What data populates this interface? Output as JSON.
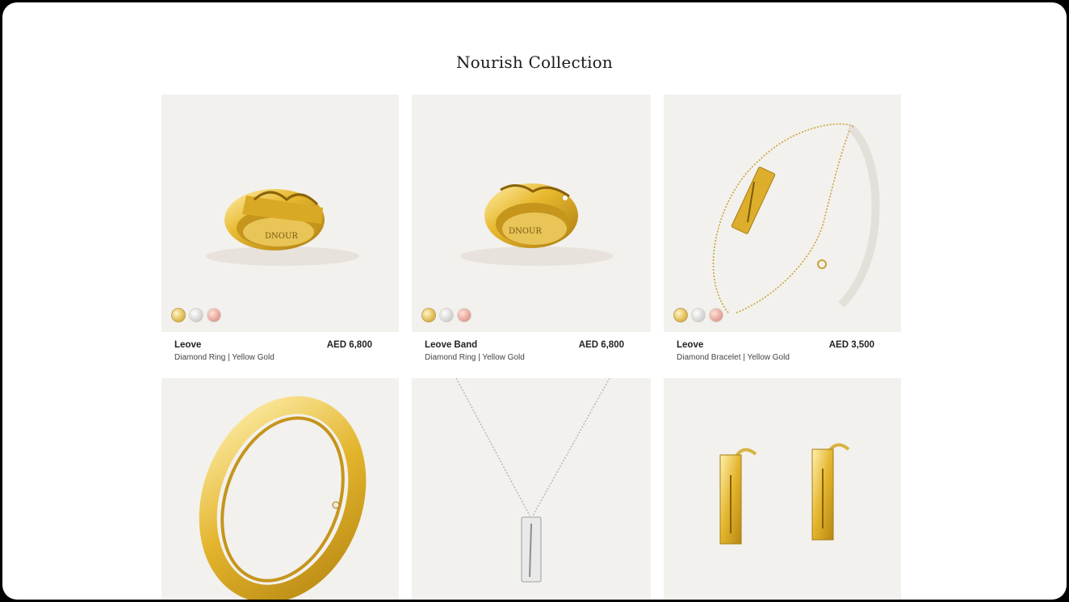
{
  "page": {
    "title": "Nourish Collection"
  },
  "products": [
    {
      "name": "Leove",
      "description": "Diamond Ring | Yellow Gold",
      "price": "AED 6,800",
      "brand_engraving": "DNOUR",
      "swatches": [
        "gold",
        "white",
        "rose"
      ]
    },
    {
      "name": "Leove Band",
      "description": "Diamond Ring | Yellow Gold",
      "price": "AED 6,800",
      "brand_engraving": "DNOUR",
      "swatches": [
        "gold",
        "white",
        "rose"
      ]
    },
    {
      "name": "Leove",
      "description": "Diamond Bracelet | Yellow Gold",
      "price": "AED 3,500",
      "swatches": [
        "gold",
        "white",
        "rose"
      ]
    },
    {
      "swatches": [
        "gold",
        "white",
        "rose"
      ]
    },
    {
      "swatches": [
        "white",
        "gold",
        "rose"
      ]
    },
    {
      "swatches": [
        "gold",
        "white",
        "rose"
      ]
    }
  ],
  "colors": {
    "image_background": "#f3f1ed",
    "gold": "#e2bd55",
    "white_gold": "#d6d6d6",
    "rose_gold": "#e6a69a"
  }
}
